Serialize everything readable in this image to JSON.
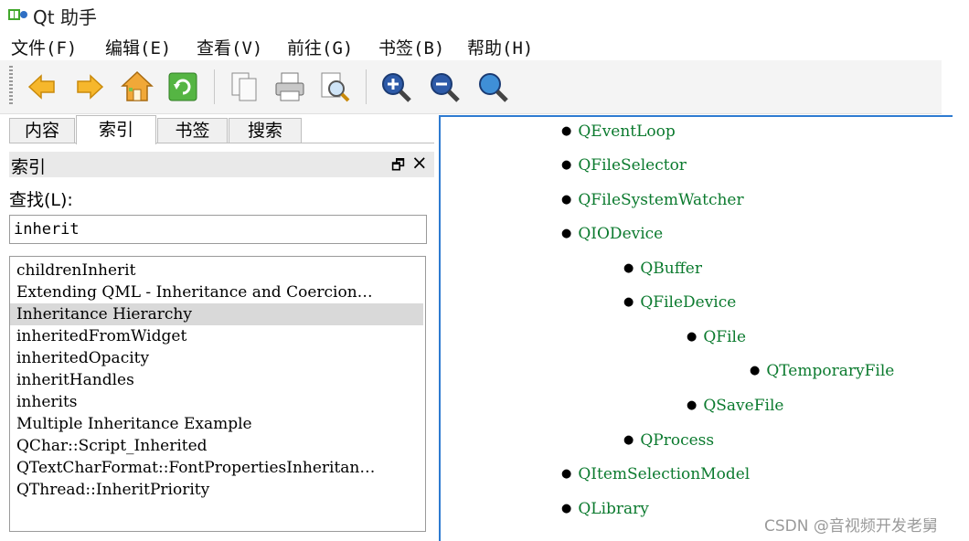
{
  "window": {
    "title": "Qt 助手"
  },
  "menu": [
    {
      "label": "文件(F)"
    },
    {
      "label": "编辑(E)"
    },
    {
      "label": "查看(V)"
    },
    {
      "label": "前往(G)"
    },
    {
      "label": "书签(B)"
    },
    {
      "label": "帮助(H)"
    }
  ],
  "toolbar": {
    "buttons": [
      {
        "icon": "back-arrow-icon"
      },
      {
        "icon": "forward-arrow-icon"
      },
      {
        "icon": "home-icon"
      },
      {
        "icon": "sync-icon"
      },
      {
        "icon": "copy-icon"
      },
      {
        "icon": "print-icon"
      },
      {
        "icon": "find-icon"
      },
      {
        "icon": "zoom-in-icon"
      },
      {
        "icon": "zoom-out-icon"
      },
      {
        "icon": "zoom-reset-icon"
      }
    ]
  },
  "sidebar": {
    "tabs": [
      {
        "label": "内容"
      },
      {
        "label": "索引"
      },
      {
        "label": "书签"
      },
      {
        "label": "搜索"
      }
    ],
    "active_tab": "索引",
    "dock_title": "索引",
    "find_label": "查找(L):",
    "search_value": "inherit",
    "index_items": [
      {
        "label": "childrenInherit"
      },
      {
        "label": "Extending QML - Inheritance and Coercion…"
      },
      {
        "label": "Inheritance Hierarchy"
      },
      {
        "label": "inheritedFromWidget"
      },
      {
        "label": "inheritedOpacity"
      },
      {
        "label": "inheritHandles"
      },
      {
        "label": "inherits"
      },
      {
        "label": "Multiple Inheritance Example"
      },
      {
        "label": "QChar::Script_Inherited"
      },
      {
        "label": "QTextCharFormat::FontPropertiesInheritan…"
      },
      {
        "label": "QThread::InheritPriority"
      }
    ],
    "selected_item": "Inheritance Hierarchy"
  },
  "content": {
    "tree": [
      {
        "label": "QEventLoop",
        "level": 0
      },
      {
        "label": "QFileSelector",
        "level": 0
      },
      {
        "label": "QFileSystemWatcher",
        "level": 0
      },
      {
        "label": "QIODevice",
        "level": 0
      },
      {
        "label": "QBuffer",
        "level": 1
      },
      {
        "label": "QFileDevice",
        "level": 1
      },
      {
        "label": "QFile",
        "level": 2
      },
      {
        "label": "QTemporaryFile",
        "level": 3
      },
      {
        "label": "QSaveFile",
        "level": 2
      },
      {
        "label": "QProcess",
        "level": 1
      },
      {
        "label": "QItemSelectionModel",
        "level": 0
      },
      {
        "label": "QLibrary",
        "level": 0
      }
    ]
  },
  "watermark": "CSDN @音视频开发老舅",
  "colors": {
    "link": "#0b7a2e",
    "accent": "#2e7bd1",
    "selection": "#d9d9d9"
  }
}
